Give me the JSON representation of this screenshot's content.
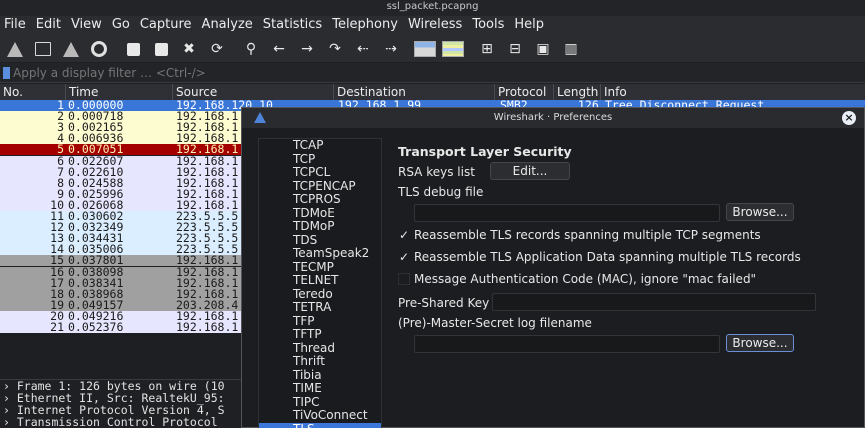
{
  "window": {
    "title": "ssl_packet.pcapng"
  },
  "menu": [
    "File",
    "Edit",
    "View",
    "Go",
    "Capture",
    "Analyze",
    "Statistics",
    "Telephony",
    "Wireless",
    "Tools",
    "Help"
  ],
  "toolbar_icons": [
    "shark-fin-start-icon",
    "stop-square-icon",
    "shark-fin-restart-icon",
    "gear-options-icon",
    "open-file-icon",
    "save-file-icon",
    "close-file-icon",
    "reload-file-icon",
    "search-icon",
    "back-arrow-icon",
    "forward-arrow-icon",
    "go-to-packet-icon",
    "first-packet-icon",
    "last-packet-icon",
    "autoscroll-icon",
    "colorize-icon",
    "zoom-in-icon",
    "zoom-out-icon",
    "zoom-reset-icon",
    "resize-columns-icon"
  ],
  "filter": {
    "placeholder": "Apply a display filter … <Ctrl-/>"
  },
  "columns": {
    "no": "No.",
    "time": "Time",
    "source": "Source",
    "destination": "Destination",
    "protocol": "Protocol",
    "length": "Length",
    "info": "Info"
  },
  "packets": [
    {
      "no": "1",
      "time": "0.000000",
      "source": "192.168.120.10",
      "destination": "192.168.1.99",
      "protocol": "SMB2",
      "length": "126",
      "info": "Tree Disconnect Request",
      "bg": "#3a76d8",
      "fg": "#ffffff"
    },
    {
      "no": "2",
      "time": "0.000718",
      "source": "192.168.1",
      "bg": "#fdfbd0",
      "fg": "#1b1b1b"
    },
    {
      "no": "3",
      "time": "0.002165",
      "source": "192.168.1",
      "bg": "#fdfbd0",
      "fg": "#1b1b1b"
    },
    {
      "no": "4",
      "time": "0.006936",
      "source": "192.168.1",
      "bg": "#fdfbd0",
      "fg": "#1b1b1b"
    },
    {
      "no": "5",
      "time": "0.007051",
      "source": "192.168.1",
      "bg": "#a40000",
      "fg": "#fff3b0"
    },
    {
      "no": "6",
      "time": "0.022607",
      "source": "192.168.1",
      "bg": "#e7e6ff",
      "fg": "#1b1b1b"
    },
    {
      "no": "7",
      "time": "0.022610",
      "source": "192.168.1",
      "bg": "#e7e6ff",
      "fg": "#1b1b1b"
    },
    {
      "no": "8",
      "time": "0.024588",
      "source": "192.168.1",
      "bg": "#e7e6ff",
      "fg": "#1b1b1b"
    },
    {
      "no": "9",
      "time": "0.025996",
      "source": "192.168.1",
      "bg": "#e7e6ff",
      "fg": "#1b1b1b"
    },
    {
      "no": "10",
      "time": "0.026068",
      "source": "192.168.1",
      "bg": "#e7e6ff",
      "fg": "#1b1b1b"
    },
    {
      "no": "11",
      "time": "0.030602",
      "source": "223.5.5.5",
      "bg": "#daeeff",
      "fg": "#1b1b1b"
    },
    {
      "no": "12",
      "time": "0.032349",
      "source": "223.5.5.5",
      "bg": "#daeeff",
      "fg": "#1b1b1b"
    },
    {
      "no": "13",
      "time": "0.034431",
      "source": "223.5.5.5",
      "bg": "#daeeff",
      "fg": "#1b1b1b"
    },
    {
      "no": "14",
      "time": "0.035006",
      "source": "223.5.5.5",
      "bg": "#daeeff",
      "fg": "#1b1b1b"
    },
    {
      "no": "15",
      "time": "0.037801",
      "source": "192.168.1",
      "bg": "#a0a0a0",
      "fg": "#1b1b1b"
    },
    {
      "no": "16",
      "time": "0.038098",
      "source": "192.168.1",
      "bg": "#a0a0a0",
      "fg": "#1b1b1b"
    },
    {
      "no": "17",
      "time": "0.038341",
      "source": "192.168.1",
      "bg": "#a0a0a0",
      "fg": "#1b1b1b"
    },
    {
      "no": "18",
      "time": "0.038968",
      "source": "192.168.1",
      "bg": "#a0a0a0",
      "fg": "#1b1b1b"
    },
    {
      "no": "19",
      "time": "0.049157",
      "source": "203.208.4",
      "bg": "#a0a0a0",
      "fg": "#1b1b1b"
    },
    {
      "no": "20",
      "time": "0.049216",
      "source": "192.168.1",
      "bg": "#e7e6ff",
      "fg": "#1b1b1b"
    },
    {
      "no": "21",
      "time": "0.052376",
      "source": "192.168.1",
      "bg": "#e7e6ff",
      "fg": "#1b1b1b"
    }
  ],
  "details": [
    "› Frame 1: 126 bytes on wire (10",
    "› Ethernet II, Src: RealtekU_95:",
    "› Internet Protocol Version 4, S",
    "› Transmission Control Protocol"
  ],
  "dialog": {
    "title": "Wireshark · Preferences",
    "tree": [
      "TCAP",
      "TCP",
      "TCPCL",
      "TCPENCAP",
      "TCPROS",
      "TDMoE",
      "TDMoP",
      "TDS",
      "TeamSpeak2",
      "TECMP",
      "TELNET",
      "Teredo",
      "TETRA",
      "TFP",
      "TFTP",
      "Thread",
      "Thrift",
      "Tibia",
      "TIME",
      "TIPC",
      "TiVoConnect",
      "TLS"
    ],
    "selected_index": 21,
    "heading": "Transport Layer Security",
    "rsa_label": "RSA keys list",
    "rsa_button": "Edit...",
    "debug_label": "TLS debug file",
    "debug_value": "",
    "browse1": "Browse...",
    "opt_reassemble_tcp": {
      "label": "Reassemble TLS records spanning multiple TCP segments",
      "checked": true
    },
    "opt_reassemble_app": {
      "label": "Reassemble TLS Application Data spanning multiple TLS records",
      "checked": true
    },
    "opt_mac": {
      "label": "Message Authentication Code (MAC), ignore \"mac failed\"",
      "checked": false
    },
    "psk_label": "Pre-Shared Key",
    "psk_value": "",
    "master_label": "(Pre)-Master-Secret log filename",
    "master_value": "",
    "browse2": "Browse..."
  }
}
